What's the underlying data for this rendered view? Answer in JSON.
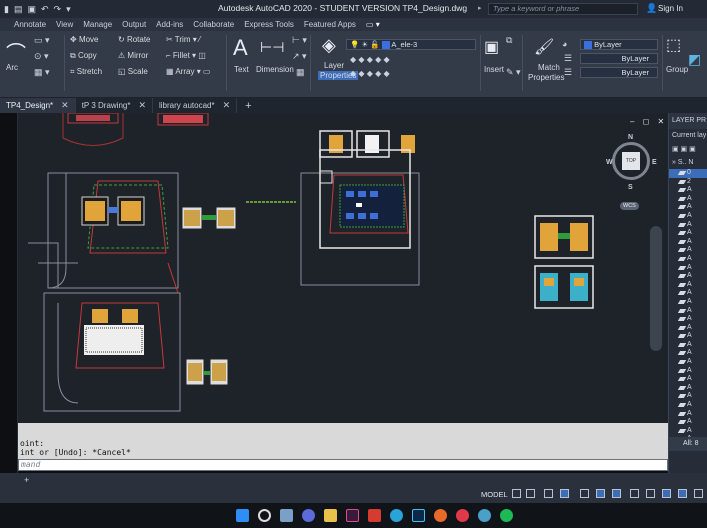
{
  "titlebar": {
    "title": "Autodesk AutoCAD 2020 - STUDENT VERSION   TP4_Design.dwg",
    "search_placeholder": "Type a keyword or phrase",
    "signin": "Sign In"
  },
  "menutabs": [
    "Annotate",
    "View",
    "Manage",
    "Output",
    "Add-ins",
    "Collaborate",
    "Express Tools",
    "Featured Apps"
  ],
  "ribbon": {
    "arc": "Arc",
    "move": "Move",
    "rotate": "Rotate",
    "trim": "Trim",
    "copy": "Copy",
    "mirror": "Mirror",
    "fillet": "Fillet",
    "stretch": "Stretch",
    "scale": "Scale",
    "array": "Array",
    "text": "Text",
    "dimension": "Dimension",
    "layer_properties_1": "Layer",
    "layer_properties_2": "Properties",
    "current_layer": "A_ele-3",
    "insert": "Insert",
    "match_properties_1": "Match",
    "match_properties_2": "Properties",
    "bylayer_1": "ByLayer",
    "bylayer_2": "ByLayer",
    "bylayer_3": "ByLayer",
    "group": "Group"
  },
  "doctabs": [
    {
      "label": "TP4_Design*",
      "active": true
    },
    {
      "label": "tP 3 Drawing*",
      "active": false
    },
    {
      "label": "library autocad*",
      "active": false
    }
  ],
  "viewcube": {
    "n": "N",
    "s": "S",
    "w": "W",
    "e": "E",
    "top": "TOP",
    "wcs": "WCS"
  },
  "layer_panel": {
    "header": "LAYER PR",
    "current_label": "Current lay",
    "filter_label": "S.. N",
    "rows": [
      "0",
      "2",
      "A",
      "A",
      "A",
      "A",
      "A",
      "A",
      "A",
      "A",
      "A",
      "A",
      "A",
      "A",
      "A",
      "A",
      "A",
      "A",
      "A",
      "A",
      "A",
      "A",
      "A",
      "A",
      "A",
      "A",
      "A",
      "A",
      "A",
      "A",
      "A",
      "A"
    ],
    "all_label": "All: 8"
  },
  "command": {
    "line1": "oint:",
    "line2": "int or [Undo]: *Cancel*",
    "input_placeholder": "mand"
  },
  "status": {
    "model": "MODEL"
  },
  "colors": {
    "accent": "#3c6db8",
    "ribbon": "#333b48",
    "canvas": "#1e2229"
  }
}
